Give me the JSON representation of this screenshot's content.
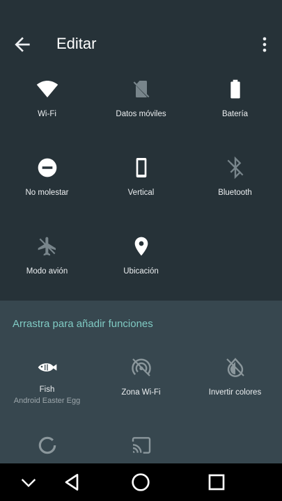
{
  "header": {
    "title": "Editar"
  },
  "active_tiles": [
    {
      "label": "Wi-Fi",
      "icon": "wifi-icon"
    },
    {
      "label": "Datos móviles",
      "icon": "mobile-data-off-icon"
    },
    {
      "label": "Batería",
      "icon": "battery-icon"
    },
    {
      "label": "No molestar",
      "icon": "do-not-disturb-icon"
    },
    {
      "label": "Vertical",
      "icon": "phone-portrait-icon"
    },
    {
      "label": "Bluetooth",
      "icon": "bluetooth-off-icon"
    },
    {
      "label": "Modo avión",
      "icon": "airplane-icon"
    },
    {
      "label": "Ubicación",
      "icon": "location-pin-icon"
    }
  ],
  "available": {
    "header": "Arrastra para añadir funciones",
    "tiles": [
      {
        "label": "Fish",
        "sublabel": "Android Easter Egg",
        "icon": "fish-icon"
      },
      {
        "label": "Zona Wi-Fi",
        "icon": "hotspot-icon"
      },
      {
        "label": "Invertir colores",
        "icon": "invert-colors-icon"
      },
      {
        "label": "",
        "icon": "data-saver-icon"
      },
      {
        "label": "",
        "icon": "cast-icon"
      }
    ]
  },
  "colors": {
    "background": "#263238",
    "section": "#37474F",
    "accent": "#80CBC4"
  }
}
